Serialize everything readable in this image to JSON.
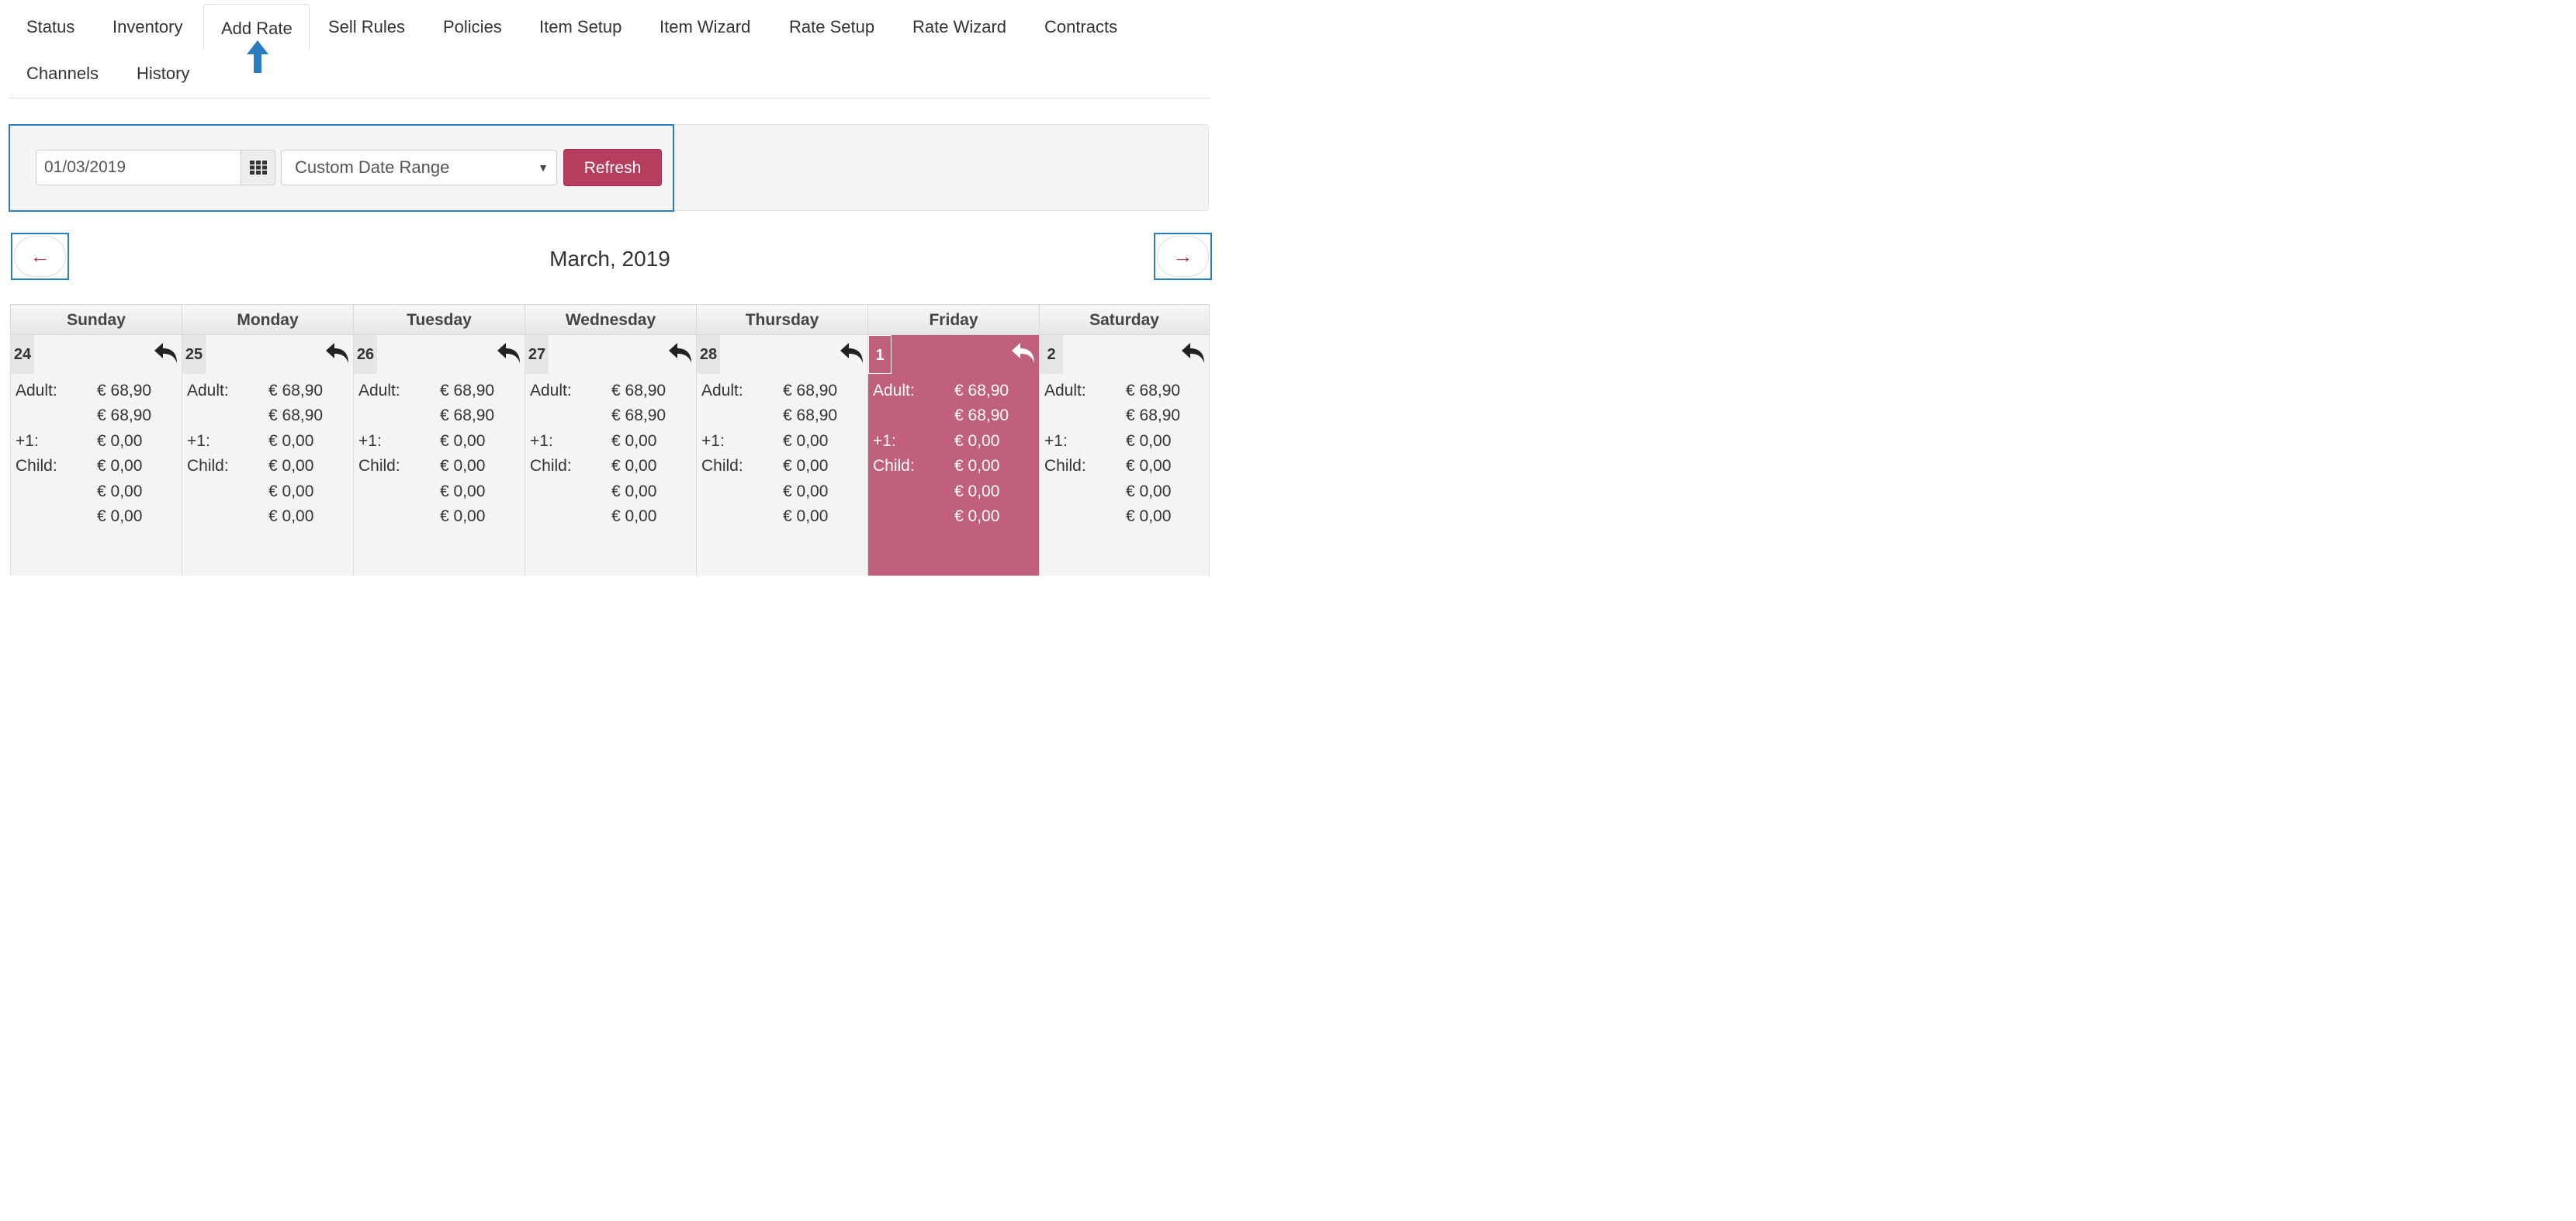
{
  "tabs": [
    {
      "label": "Status"
    },
    {
      "label": "Inventory"
    },
    {
      "label": "Add Rate"
    },
    {
      "label": "Sell Rules"
    },
    {
      "label": "Policies"
    },
    {
      "label": "Item Setup"
    },
    {
      "label": "Item Wizard"
    },
    {
      "label": "Rate Setup"
    },
    {
      "label": "Rate Wizard"
    },
    {
      "label": "Contracts"
    },
    {
      "label": "Channels"
    },
    {
      "label": "History"
    }
  ],
  "active_tab": "Add Rate",
  "toolbar": {
    "date_value": "01/03/2019",
    "range_select": "Custom Date Range",
    "refresh_label": "Refresh"
  },
  "nav": {
    "prev": "←",
    "next": "→"
  },
  "month_title": "March, 2019",
  "calendar": {
    "weekdays": [
      "Sunday",
      "Monday",
      "Tuesday",
      "Wednesday",
      "Thursday",
      "Friday",
      "Saturday"
    ],
    "days": [
      {
        "day": "24",
        "rows": [
          [
            "Adult:",
            "€ 68,90"
          ],
          [
            "",
            "€ 68,90"
          ],
          [
            "+1:",
            "€ 0,00"
          ],
          [
            "Child:",
            "€ 0,00"
          ],
          [
            "",
            "€ 0,00"
          ],
          [
            "",
            "€ 0,00"
          ]
        ]
      },
      {
        "day": "25",
        "rows": [
          [
            "Adult:",
            "€ 68,90"
          ],
          [
            "",
            "€ 68,90"
          ],
          [
            "+1:",
            "€ 0,00"
          ],
          [
            "Child:",
            "€ 0,00"
          ],
          [
            "",
            "€ 0,00"
          ],
          [
            "",
            "€ 0,00"
          ]
        ]
      },
      {
        "day": "26",
        "rows": [
          [
            "Adult:",
            "€ 68,90"
          ],
          [
            "",
            "€ 68,90"
          ],
          [
            "+1:",
            "€ 0,00"
          ],
          [
            "Child:",
            "€ 0,00"
          ],
          [
            "",
            "€ 0,00"
          ],
          [
            "",
            "€ 0,00"
          ]
        ]
      },
      {
        "day": "27",
        "rows": [
          [
            "Adult:",
            "€ 68,90"
          ],
          [
            "",
            "€ 68,90"
          ],
          [
            "+1:",
            "€ 0,00"
          ],
          [
            "Child:",
            "€ 0,00"
          ],
          [
            "",
            "€ 0,00"
          ],
          [
            "",
            "€ 0,00"
          ]
        ]
      },
      {
        "day": "28",
        "rows": [
          [
            "Adult:",
            "€ 68,90"
          ],
          [
            "",
            "€ 68,90"
          ],
          [
            "+1:",
            "€ 0,00"
          ],
          [
            "Child:",
            "€ 0,00"
          ],
          [
            "",
            "€ 0,00"
          ],
          [
            "",
            "€ 0,00"
          ]
        ]
      },
      {
        "day": "1",
        "selected": true,
        "rows": [
          [
            "Adult:",
            "€ 68,90"
          ],
          [
            "",
            "€ 68,90"
          ],
          [
            "+1:",
            "€ 0,00"
          ],
          [
            "Child:",
            "€ 0,00"
          ],
          [
            "",
            "€ 0,00"
          ],
          [
            "",
            "€ 0,00"
          ]
        ]
      },
      {
        "day": "2",
        "rows": [
          [
            "Adult:",
            "€ 68,90"
          ],
          [
            "",
            "€ 68,90"
          ],
          [
            "+1:",
            "€ 0,00"
          ],
          [
            "Child:",
            "€ 0,00"
          ],
          [
            "",
            "€ 0,00"
          ],
          [
            "",
            "€ 0,00"
          ]
        ]
      }
    ]
  },
  "colors": {
    "accent": "#b73d5e",
    "selected_day": "#c0607a",
    "highlight_border": "#2b7bc0"
  }
}
